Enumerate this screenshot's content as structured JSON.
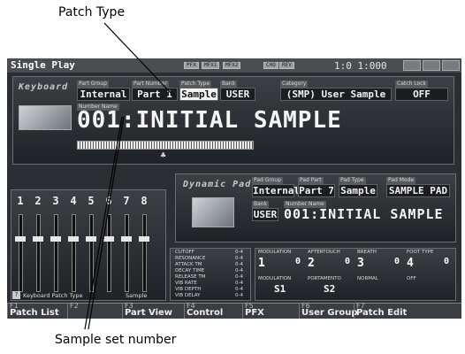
{
  "annotations": {
    "patch_type": "Patch  Type",
    "sample_set": "Sample set number"
  },
  "window": {
    "title": "Single Play",
    "time": "1:0 1:000",
    "mini_labels": [
      "PFX",
      "MFX1",
      "MFX2",
      "CHO",
      "REV",
      "",
      "",
      ""
    ]
  },
  "keyboard": {
    "label": "Keyboard",
    "fields": [
      {
        "label": "Part Group",
        "value": "Internal"
      },
      {
        "label": "Part Number",
        "value": "Part 1"
      },
      {
        "label": "Patch Type",
        "value": "Sample"
      },
      {
        "label": "Bank",
        "value": "USER"
      },
      {
        "label": "Category",
        "value": "(SMP) User Sample"
      },
      {
        "label": "Catch Lock",
        "value": "OFF"
      }
    ],
    "name_label": "Number Name",
    "patch_name": "001:INITIAL SAMPLE"
  },
  "dynamic_pad": {
    "label": "Dynamic Pad",
    "fields": [
      {
        "label": "Pad Group",
        "value": "Internal"
      },
      {
        "label": "Pad Part",
        "value": "Part 7"
      },
      {
        "label": "Pad Type",
        "value": "Sample"
      },
      {
        "label": "Pad Mode",
        "value": "SAMPLE PAD"
      }
    ],
    "bank_label": "Bank",
    "bank": "USER",
    "name_label": "Number Name",
    "patch_name": "001:INITIAL SAMPLE"
  },
  "mixer": {
    "channels": [
      "1",
      "2",
      "3",
      "4",
      "5",
      "6",
      "7",
      "8"
    ],
    "fader_levels": [
      0.72,
      0.72,
      0.72,
      0.72,
      0.72,
      0.72,
      0.72,
      0.72
    ],
    "footer_left": "Keyboard Patch Type",
    "footer_right": "Sample"
  },
  "params": {
    "names": [
      "CUTOFF",
      "RESONANCE",
      "ATTACK TM",
      "DECAY TIME",
      "RELEASE TM",
      "VIB RATE",
      "VIB DEPTH",
      "VIB DELAY"
    ],
    "values": [
      "0-4",
      "0-4",
      "0-4",
      "0-4",
      "0-4",
      "0-4",
      "0-4",
      "0-4"
    ]
  },
  "controllers": {
    "top": [
      {
        "label": "MODULATION",
        "num": "1",
        "val": "0"
      },
      {
        "label": "AFTERTOUCH",
        "num": "2",
        "val": "0"
      },
      {
        "label": "BREATH",
        "num": "3",
        "val": "0"
      },
      {
        "label": "FOOT TYPE",
        "num": "4",
        "val": "0"
      }
    ],
    "bottom": [
      {
        "label": "MODULATION",
        "val": "S1"
      },
      {
        "label": "PORTAMENTO",
        "val": "S2"
      },
      {
        "label": "NORMAL",
        "val": ""
      },
      {
        "label": "OFF",
        "val": ""
      }
    ]
  },
  "function_keys": [
    {
      "key": "F1",
      "label": "Patch List"
    },
    {
      "key": "F2",
      "label": ""
    },
    {
      "key": "F3",
      "label": "Part View"
    },
    {
      "key": "F4",
      "label": "Control"
    },
    {
      "key": "F5",
      "label": "PFX"
    },
    {
      "key": "F6",
      "label": "User Group"
    },
    {
      "key": "F7",
      "label": "Patch Edit"
    }
  ]
}
